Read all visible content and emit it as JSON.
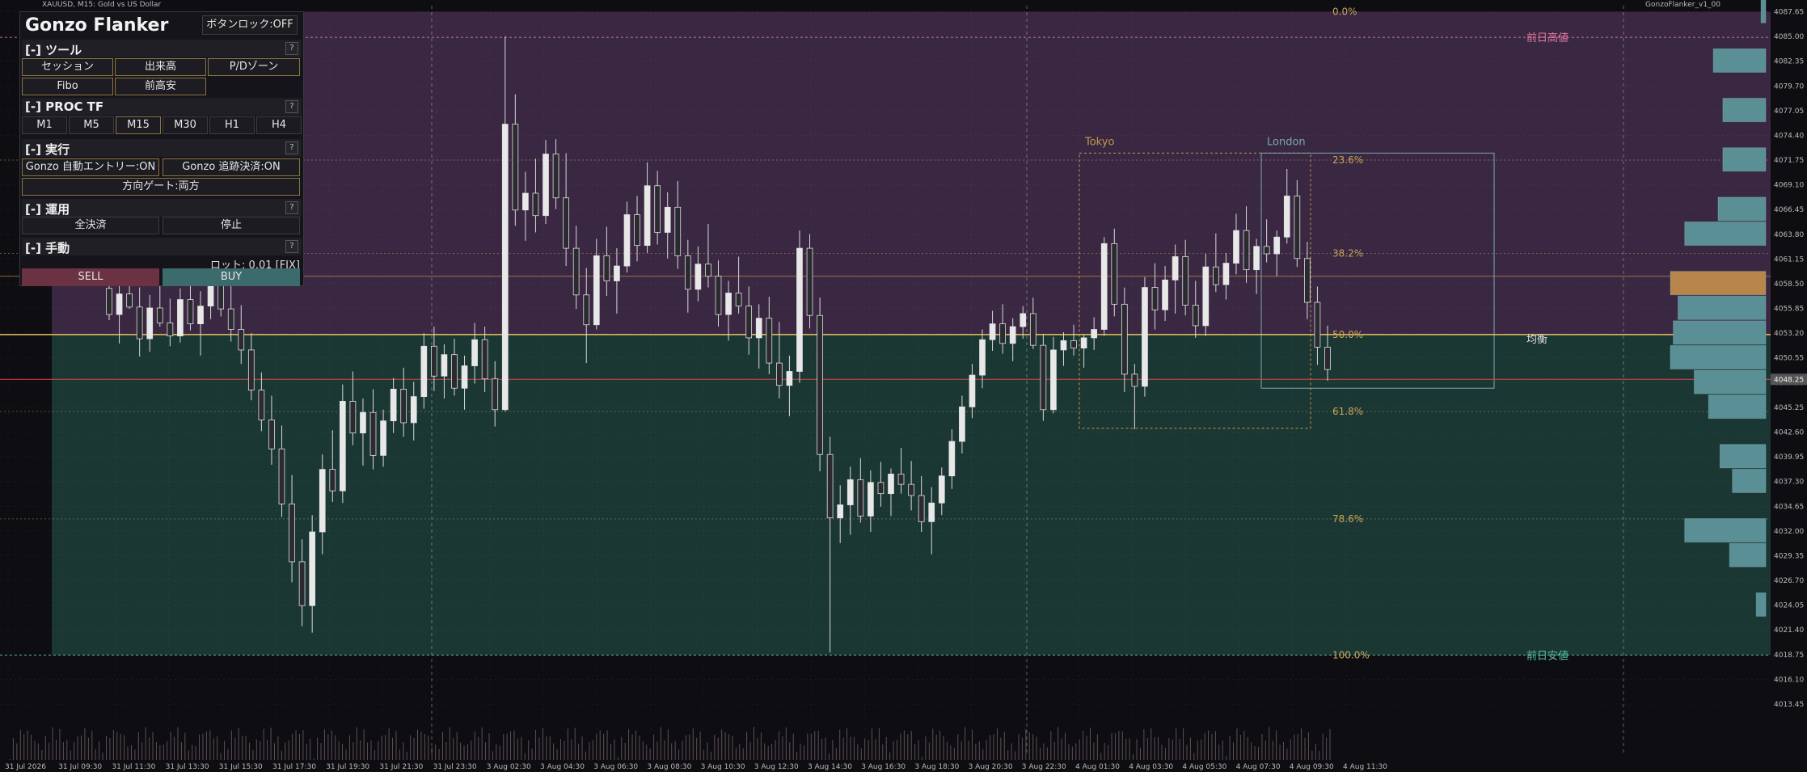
{
  "window": {
    "symbol_title": "XAUUSD, M15: Gold vs US Dollar",
    "indicator_title": "GonzoFlanker_v1_00"
  },
  "panel": {
    "title": "Gonzo Flanker",
    "button_lock": "ボタンロック:OFF",
    "sec_tools": "[-] ツール",
    "tools": [
      "セッション",
      "出来高",
      "P/Dゾーン",
      "Fibo",
      "前高安"
    ],
    "sec_tf": "[-] PROC TF",
    "timeframes": [
      "M1",
      "M5",
      "M15",
      "M30",
      "H1",
      "H4"
    ],
    "sec_exec": "[-] 実行",
    "auto_entry": "Gonzo 自動エントリー:ON",
    "trail": "Gonzo 追跡決済:ON",
    "direction_gate": "方向ゲート:両方",
    "sec_ops": "[-] 運用",
    "close_all": "全決済",
    "stop": "停止",
    "sec_manual": "[-] 手動",
    "lot": "ロット: 0.01 [FIX]",
    "sell": "SELL",
    "buy": "BUY",
    "help": "?"
  },
  "chart_data": {
    "type": "candlestick",
    "symbol": "XAUUSD",
    "timeframe": "M15",
    "price_ticks": [
      "4087.65",
      "4085.00",
      "4082.35",
      "4079.70",
      "4077.05",
      "4074.40",
      "4071.75",
      "4069.10",
      "4066.45",
      "4063.80",
      "4061.15",
      "4058.50",
      "4055.85",
      "4053.20",
      "4050.55",
      "4047.90",
      "4045.25",
      "4042.60",
      "4039.95",
      "4037.30",
      "4034.65",
      "4032.00",
      "4029.35",
      "4026.70",
      "4024.05",
      "4021.40",
      "4018.75",
      "4016.10",
      "4013.45"
    ],
    "current_price": "4048.25",
    "time_ticks": [
      "31 Jul 2026",
      "31 Jul 09:30",
      "31 Jul 11:30",
      "31 Jul 13:30",
      "31 Jul 15:30",
      "31 Jul 17:30",
      "31 Jul 19:30",
      "31 Jul 21:30",
      "31 Jul 23:30",
      "3 Aug 02:30",
      "3 Aug 04:30",
      "3 Aug 06:30",
      "3 Aug 08:30",
      "3 Aug 10:30",
      "3 Aug 12:30",
      "3 Aug 14:30",
      "3 Aug 16:30",
      "3 Aug 18:30",
      "3 Aug 20:30",
      "3 Aug 22:30",
      "4 Aug 01:30",
      "4 Aug 03:30",
      "4 Aug 05:30",
      "4 Aug 07:30",
      "4 Aug 09:30",
      "4 Aug 11:30"
    ],
    "fib_levels": [
      {
        "label": "0.0%",
        "price": 4087.65
      },
      {
        "label": "23.6%",
        "price": 4071.75
      },
      {
        "label": "38.2%",
        "price": 4061.75
      },
      {
        "label": "50.0%",
        "price": 4053.05
      },
      {
        "label": "61.8%",
        "price": 4044.8
      },
      {
        "label": "78.6%",
        "price": 4033.3
      },
      {
        "label": "100.0%",
        "price": 4018.7
      }
    ],
    "labels": {
      "prev_high": "前日高値",
      "equilibrium": "均衡",
      "prev_low": "前日安値",
      "tokyo": "Tokyo",
      "london": "London"
    },
    "ylim": [
      4010.5,
      4088.3
    ],
    "candles": [
      [
        4058.0,
        4061.8,
        4054.6,
        4055.2
      ],
      [
        4055.2,
        4058.9,
        4052.1,
        4057.4
      ],
      [
        4057.4,
        4062.4,
        4055.8,
        4056.0
      ],
      [
        4056.0,
        4058.1,
        4050.7,
        4052.6
      ],
      [
        4052.6,
        4057.3,
        4051.2,
        4055.9
      ],
      [
        4055.9,
        4059.6,
        4053.9,
        4054.3
      ],
      [
        4054.3,
        4056.9,
        4051.8,
        4052.9
      ],
      [
        4052.9,
        4058.0,
        4052.2,
        4056.8
      ],
      [
        4056.8,
        4061.1,
        4053.5,
        4054.2
      ],
      [
        4054.2,
        4057.7,
        4050.8,
        4056.1
      ],
      [
        4056.1,
        4060.9,
        4054.7,
        4058.9
      ],
      [
        4058.9,
        4062.2,
        4055.0,
        4055.8
      ],
      [
        4055.8,
        4059.1,
        4052.3,
        4053.6
      ],
      [
        4053.6,
        4056.2,
        4049.9,
        4051.4
      ],
      [
        4051.4,
        4053.2,
        4046.0,
        4047.1
      ],
      [
        4047.1,
        4049.0,
        4042.7,
        4043.9
      ],
      [
        4043.9,
        4046.5,
        4039.1,
        4040.8
      ],
      [
        4040.8,
        4043.3,
        4033.5,
        4034.9
      ],
      [
        4034.9,
        4038.0,
        4026.5,
        4028.7
      ],
      [
        4028.7,
        4031.1,
        4021.8,
        4024.0
      ],
      [
        4024.0,
        4033.7,
        4021.1,
        4031.9
      ],
      [
        4031.9,
        4040.2,
        4029.5,
        4038.6
      ],
      [
        4038.6,
        4042.8,
        4035.1,
        4036.3
      ],
      [
        4036.3,
        4047.7,
        4035.0,
        4045.9
      ],
      [
        4045.9,
        4049.1,
        4041.2,
        4042.5
      ],
      [
        4042.5,
        4046.2,
        4039.0,
        4044.7
      ],
      [
        4044.7,
        4047.2,
        4038.6,
        4040.1
      ],
      [
        4040.1,
        4045.0,
        4038.9,
        4043.8
      ],
      [
        4043.8,
        4048.4,
        4042.5,
        4047.2
      ],
      [
        4047.2,
        4049.5,
        4042.1,
        4043.6
      ],
      [
        4043.6,
        4048.0,
        4041.7,
        4046.4
      ],
      [
        4046.4,
        4053.2,
        4045.1,
        4051.8
      ],
      [
        4051.8,
        4053.9,
        4047.0,
        4048.6
      ],
      [
        4048.6,
        4052.0,
        4046.2,
        4050.9
      ],
      [
        4050.9,
        4052.6,
        4046.5,
        4047.3
      ],
      [
        4047.3,
        4050.8,
        4045.0,
        4049.7
      ],
      [
        4049.7,
        4054.3,
        4047.8,
        4052.5
      ],
      [
        4052.5,
        4053.9,
        4046.9,
        4048.3
      ],
      [
        4048.3,
        4050.2,
        4043.2,
        4045.0
      ],
      [
        4045.0,
        4085.0,
        4044.8,
        4075.6
      ],
      [
        4075.6,
        4078.8,
        4064.7,
        4066.4
      ],
      [
        4066.4,
        4070.5,
        4063.1,
        4068.2
      ],
      [
        4068.2,
        4071.9,
        4064.0,
        4065.8
      ],
      [
        4065.8,
        4073.9,
        4064.9,
        4072.4
      ],
      [
        4072.4,
        4074.0,
        4066.5,
        4067.7
      ],
      [
        4067.7,
        4072.5,
        4060.4,
        4062.3
      ],
      [
        4062.3,
        4064.7,
        4055.8,
        4057.3
      ],
      [
        4057.3,
        4060.2,
        4050.0,
        4054.1
      ],
      [
        4054.1,
        4063.3,
        4053.6,
        4061.5
      ],
      [
        4061.5,
        4064.6,
        4057.2,
        4058.8
      ],
      [
        4058.8,
        4062.3,
        4055.3,
        4060.4
      ],
      [
        4060.4,
        4067.3,
        4059.7,
        4065.9
      ],
      [
        4065.9,
        4067.9,
        4060.9,
        4062.6
      ],
      [
        4062.6,
        4071.5,
        4061.8,
        4069.0
      ],
      [
        4069.0,
        4070.6,
        4062.7,
        4064.0
      ],
      [
        4064.0,
        4068.3,
        4061.2,
        4066.7
      ],
      [
        4066.7,
        4069.5,
        4060.1,
        4061.5
      ],
      [
        4061.5,
        4063.2,
        4055.4,
        4057.9
      ],
      [
        4057.9,
        4062.5,
        4056.6,
        4060.6
      ],
      [
        4060.6,
        4064.9,
        4058.1,
        4059.3
      ],
      [
        4059.3,
        4061.0,
        4053.9,
        4055.2
      ],
      [
        4055.2,
        4058.8,
        4052.4,
        4057.5
      ],
      [
        4057.5,
        4061.4,
        4055.3,
        4056.1
      ],
      [
        4056.1,
        4058.2,
        4050.9,
        4052.7
      ],
      [
        4052.7,
        4056.3,
        4049.4,
        4054.8
      ],
      [
        4054.8,
        4057.1,
        4048.8,
        4050.0
      ],
      [
        4050.0,
        4054.4,
        4046.2,
        4047.6
      ],
      [
        4047.6,
        4050.8,
        4044.3,
        4049.1
      ],
      [
        4049.1,
        4064.2,
        4047.9,
        4062.3
      ],
      [
        4062.3,
        4063.8,
        4053.7,
        4055.1
      ],
      [
        4055.1,
        4057.0,
        4038.4,
        4040.2
      ],
      [
        4040.2,
        4042.1,
        4019.0,
        4033.4
      ],
      [
        4033.4,
        4036.9,
        4030.7,
        4034.8
      ],
      [
        4034.8,
        4038.9,
        4031.6,
        4037.5
      ],
      [
        4037.5,
        4039.8,
        4032.9,
        4033.6
      ],
      [
        4033.6,
        4038.5,
        4031.9,
        4037.2
      ],
      [
        4037.2,
        4039.4,
        4034.6,
        4036.0
      ],
      [
        4036.0,
        4038.7,
        4033.6,
        4038.1
      ],
      [
        4038.1,
        4040.9,
        4036.0,
        4037.0
      ],
      [
        4037.0,
        4039.5,
        4034.2,
        4035.8
      ],
      [
        4035.8,
        4037.9,
        4031.9,
        4033.0
      ],
      [
        4033.0,
        4036.7,
        4029.5,
        4035.0
      ],
      [
        4035.0,
        4038.8,
        4033.7,
        4037.9
      ],
      [
        4037.9,
        4042.9,
        4036.5,
        4041.6
      ],
      [
        4041.6,
        4046.5,
        4040.3,
        4045.3
      ],
      [
        4045.3,
        4049.9,
        4044.1,
        4048.7
      ],
      [
        4048.7,
        4053.6,
        4047.3,
        4052.5
      ],
      [
        4052.5,
        4055.6,
        4051.3,
        4054.2
      ],
      [
        4054.2,
        4056.3,
        4051.0,
        4052.1
      ],
      [
        4052.1,
        4054.8,
        4050.2,
        4053.9
      ],
      [
        4053.9,
        4056.1,
        4052.6,
        4055.3
      ],
      [
        4055.3,
        4057.0,
        4051.5,
        4051.9
      ],
      [
        4051.9,
        4053.1,
        4043.8,
        4045.0
      ],
      [
        4045.0,
        4052.8,
        4044.6,
        4051.4
      ],
      [
        4051.4,
        4053.3,
        4049.7,
        4052.4
      ],
      [
        4052.4,
        4054.1,
        4050.8,
        4051.6
      ],
      [
        4051.6,
        4053.0,
        4049.5,
        4052.7
      ],
      [
        4052.7,
        4054.9,
        4051.4,
        4053.6
      ],
      [
        4053.6,
        4063.5,
        4052.9,
        4062.8
      ],
      [
        4062.8,
        4064.4,
        4055.0,
        4056.3
      ],
      [
        4056.3,
        4058.1,
        4046.9,
        4048.8
      ],
      [
        4048.8,
        4049.9,
        4042.9,
        4047.5
      ],
      [
        4047.5,
        4059.2,
        4046.4,
        4058.1
      ],
      [
        4058.1,
        4060.7,
        4053.6,
        4055.7
      ],
      [
        4055.7,
        4060.4,
        4054.5,
        4058.9
      ],
      [
        4058.9,
        4062.7,
        4055.3,
        4061.4
      ],
      [
        4061.4,
        4063.2,
        4055.1,
        4056.2
      ],
      [
        4056.2,
        4058.8,
        4052.7,
        4054.0
      ],
      [
        4054.0,
        4061.7,
        4052.9,
        4060.3
      ],
      [
        4060.3,
        4063.9,
        4057.6,
        4058.4
      ],
      [
        4058.4,
        4061.8,
        4056.8,
        4060.7
      ],
      [
        4060.7,
        4066.0,
        4059.5,
        4064.2
      ],
      [
        4064.2,
        4066.8,
        4058.6,
        4060.0
      ],
      [
        4060.0,
        4063.3,
        4057.4,
        4062.5
      ],
      [
        4062.5,
        4065.4,
        4060.8,
        4061.7
      ],
      [
        4061.7,
        4064.2,
        4059.3,
        4063.5
      ],
      [
        4063.5,
        4070.8,
        4062.8,
        4067.9
      ],
      [
        4067.9,
        4069.6,
        4060.3,
        4061.2
      ],
      [
        4061.2,
        4063.0,
        4054.7,
        4056.5
      ],
      [
        4056.5,
        4058.2,
        4049.8,
        4051.7
      ],
      [
        4051.7,
        4054.0,
        4048.1,
        4049.3
      ]
    ],
    "volume_profile_bins": [
      {
        "price": 4087.65,
        "rel": 0.05
      },
      {
        "price": 4082.35,
        "rel": 0.55
      },
      {
        "price": 4077.05,
        "rel": 0.45
      },
      {
        "price": 4071.75,
        "rel": 0.45
      },
      {
        "price": 4066.45,
        "rel": 0.5
      },
      {
        "price": 4063.8,
        "rel": 0.85
      },
      {
        "price": 4058.5,
        "rel": 1.0
      },
      {
        "price": 4055.85,
        "rel": 0.92
      },
      {
        "price": 4053.2,
        "rel": 0.97
      },
      {
        "price": 4050.55,
        "rel": 1.0
      },
      {
        "price": 4047.9,
        "rel": 0.75
      },
      {
        "price": 4045.25,
        "rel": 0.6
      },
      {
        "price": 4039.95,
        "rel": 0.48
      },
      {
        "price": 4037.3,
        "rel": 0.35
      },
      {
        "price": 4032.0,
        "rel": 0.85
      },
      {
        "price": 4029.35,
        "rel": 0.38
      },
      {
        "price": 4024.05,
        "rel": 0.1
      }
    ],
    "volume_profile_poc_price": 4058.5
  },
  "colors": {
    "premium_zone": "#3a2742",
    "discount_zone": "#1b3733",
    "bull_candle": "#d9d9d9",
    "bear_candle": "#d9d9d9",
    "fib_text": "#c8a55a",
    "prev_high": "#e07aa0",
    "prev_low": "#58c0a0",
    "equilibrium_line": "#e8c15a",
    "current_line": "#e0464c",
    "tokyo_box": "#c09a4d",
    "london_box": "#7aa9b0",
    "sell": "#6b3243",
    "buy": "#3b6b6b",
    "profile": "#5b8f96",
    "profile_poc": "#b8864a"
  }
}
